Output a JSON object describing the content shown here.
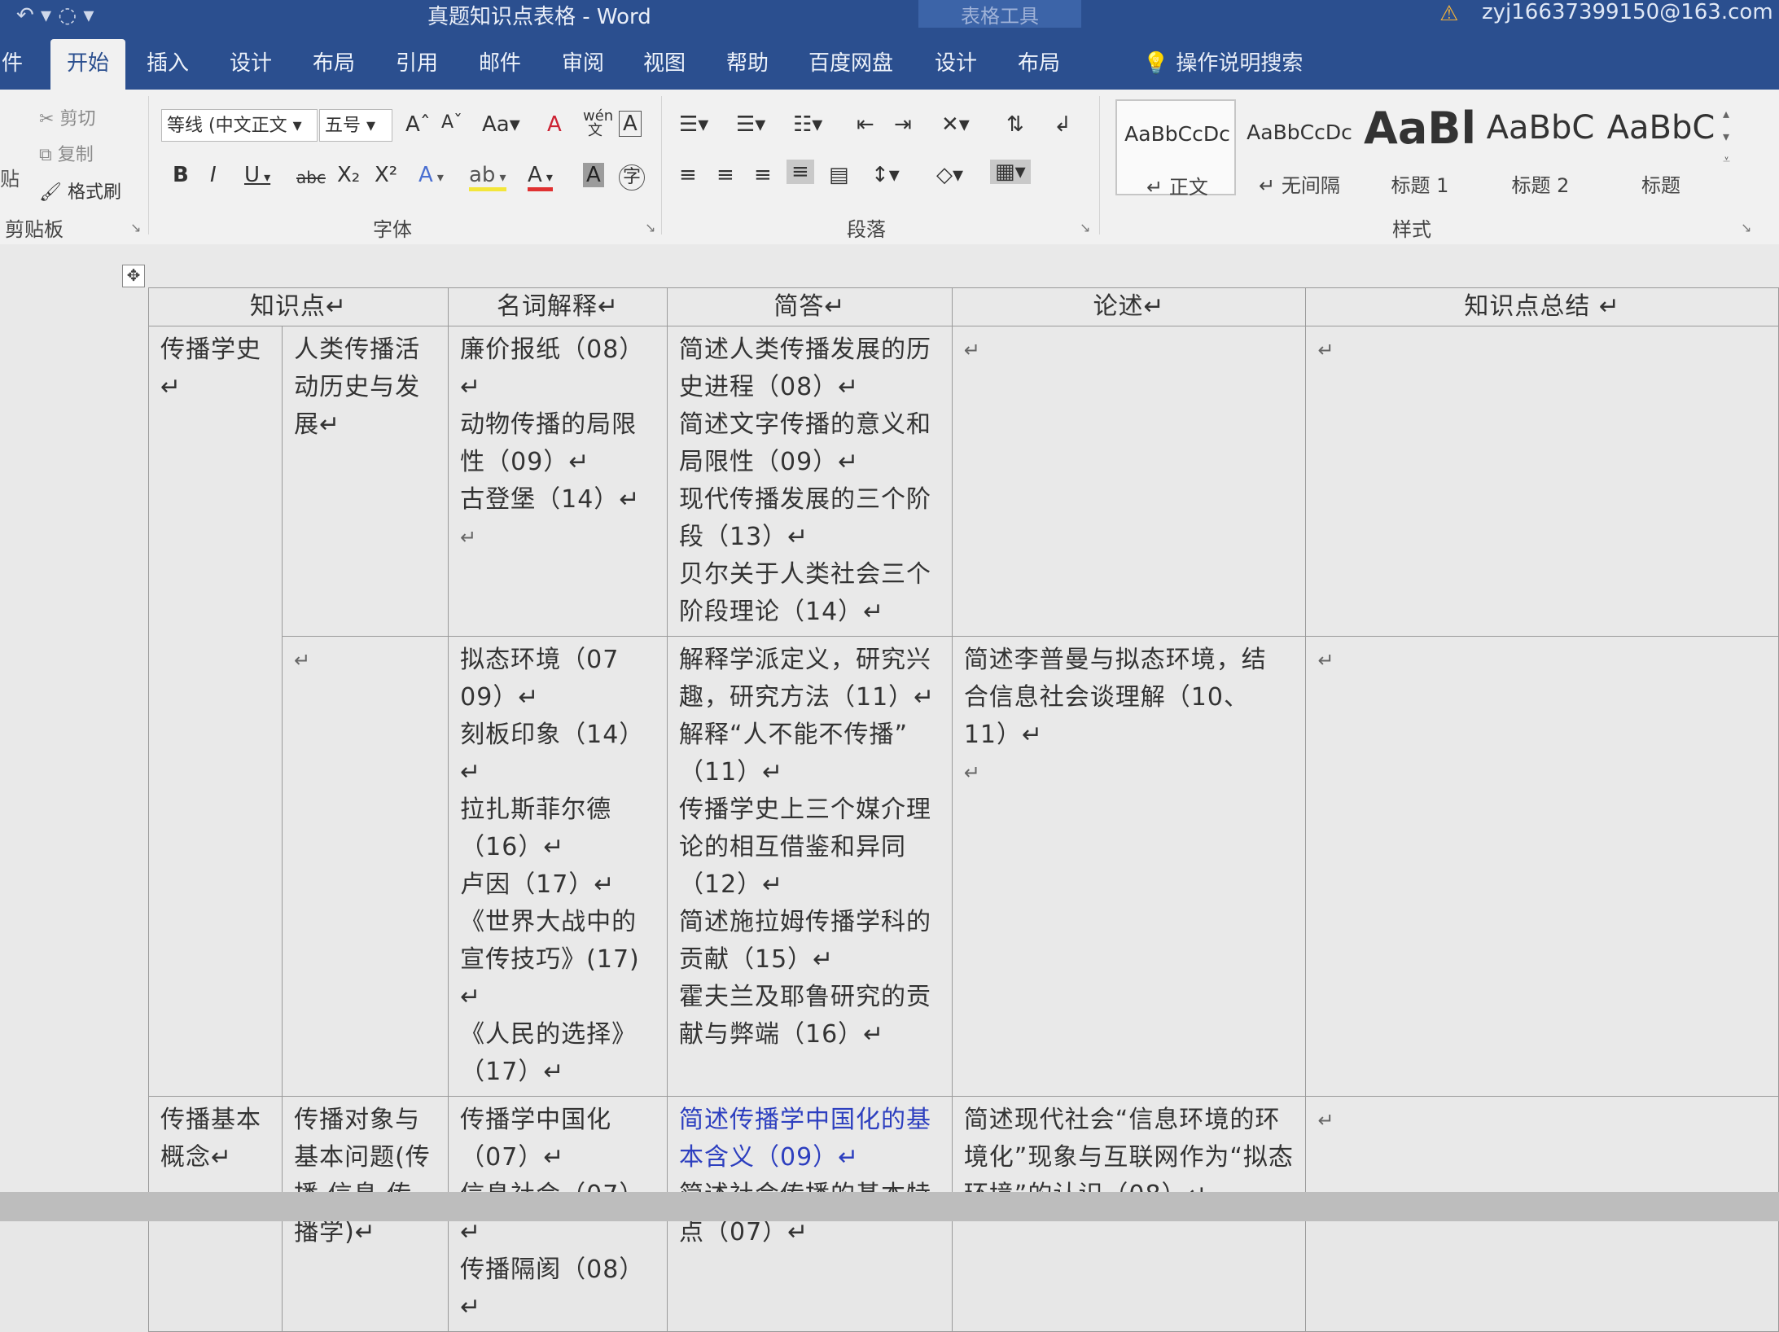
{
  "titlebar": {
    "doc_title": "真题知识点表格  -  Word",
    "context_tab": "表格工具",
    "user": "zyj16637399150@163.com",
    "quick_access": "↶ ▾ ◌ ▾"
  },
  "tabs": [
    "件",
    "开始",
    "插入",
    "设计",
    "布局",
    "引用",
    "邮件",
    "审阅",
    "视图",
    "帮助",
    "百度网盘",
    "设计",
    "布局"
  ],
  "tell_me": "操作说明搜索",
  "clipboard": {
    "paste": "贴",
    "cut": "剪切",
    "copy": "复制",
    "format_painter": "格式刷",
    "label": "剪贴板"
  },
  "font": {
    "name": "等线 (中文正文",
    "size": "五号",
    "grow": "Aˆ",
    "shrink": "Aˇ",
    "case": "Aa",
    "clear": "A",
    "phonetic": "wén文",
    "border_char": "A",
    "bold": "B",
    "italic": "I",
    "underline": "U",
    "strike": "abc",
    "subscript": "X₂",
    "superscript": "X²",
    "text_effect": "A",
    "highlight": "ab",
    "font_color": "A",
    "shading": "A",
    "enclose": "字",
    "label": "字体"
  },
  "paragraph": {
    "label": "段落"
  },
  "styles": {
    "label": "样式",
    "items": [
      {
        "sample": "AaBbCcDc",
        "name": "↵ 正文"
      },
      {
        "sample": "AaBbCcDc",
        "name": "↵ 无间隔"
      },
      {
        "sample": "AaBl",
        "name": "标题 1"
      },
      {
        "sample": "AaBbC",
        "name": "标题 2"
      },
      {
        "sample": "AaBbC",
        "name": "标题"
      }
    ]
  },
  "colors": {
    "title_blue": "#2b4f8f",
    "link_blue": "#2d3fbf",
    "red": "#d23a3a"
  },
  "table": {
    "headers": [
      "知识点↵",
      "名词解释↵",
      "简答↵",
      "论述↵",
      "知识点总结 ↵"
    ],
    "r1": {
      "cat": "传播学史↵",
      "sub": [
        "人类传播活",
        "动历史与发",
        "展↵"
      ],
      "terms": [
        "廉价报纸（08）↵",
        "动物传播的局限",
        "性（09）↵",
        "古登堡（14）↵",
        "↵"
      ],
      "short": [
        "简述人类传播发展的历",
        "史进程（08）↵",
        "简述文字传播的意义和",
        "局限性（09）↵",
        "现代传播发展的三个阶",
        "段（13）↵",
        "贝尔关于人类社会三个",
        "阶段理论（14）↵"
      ],
      "essay": "↵",
      "summary": "↵"
    },
    "r2": {
      "sub": "↵",
      "terms": [
        "拟态环境（07 09）↵",
        "刻板印象（14）↵",
        "拉扎斯菲尔德",
        "（16）↵",
        "卢因（17）↵",
        "《世界大战中的",
        "宣传技巧》(17) ↵",
        "《人民的选择》",
        "（17）↵"
      ],
      "short": [
        "解释学派定义，研究兴",
        "趣，研究方法（11）↵",
        "解释“人不能不传播”",
        "（11）↵",
        "传播学史上三个媒介理",
        "论的相互借鉴和异同",
        "（12）↵",
        "简述施拉姆传播学科的",
        "贡献（15）↵",
        "霍夫兰及耶鲁研究的贡",
        "献与弊端（16）↵"
      ],
      "essay": [
        "简述李普曼与拟态环境，结",
        "合信息社会谈理解（10、11）↵",
        "↵"
      ],
      "summary": "↵"
    },
    "r3": {
      "cat": [
        "传播基本",
        "概念↵"
      ],
      "sub": [
        "传播对象与",
        "基本问题(传",
        "播 信息 传",
        "播学)↵"
      ],
      "terms": [
        "传播学中国化",
        "（07）↵",
        "信息社会（07）↵",
        "传播隔阂（08）↵"
      ],
      "short_blue": [
        "简述传播学中国化的基",
        "本含义（09）↵"
      ],
      "short": [
        "简述社会传播的基本特",
        "点（07）↵"
      ],
      "essay": [
        "简述现代社会“信息环境的环",
        "境化”现象与互联网作为“拟态",
        "环境”的认识（08）↵"
      ],
      "summary": "↵"
    }
  }
}
